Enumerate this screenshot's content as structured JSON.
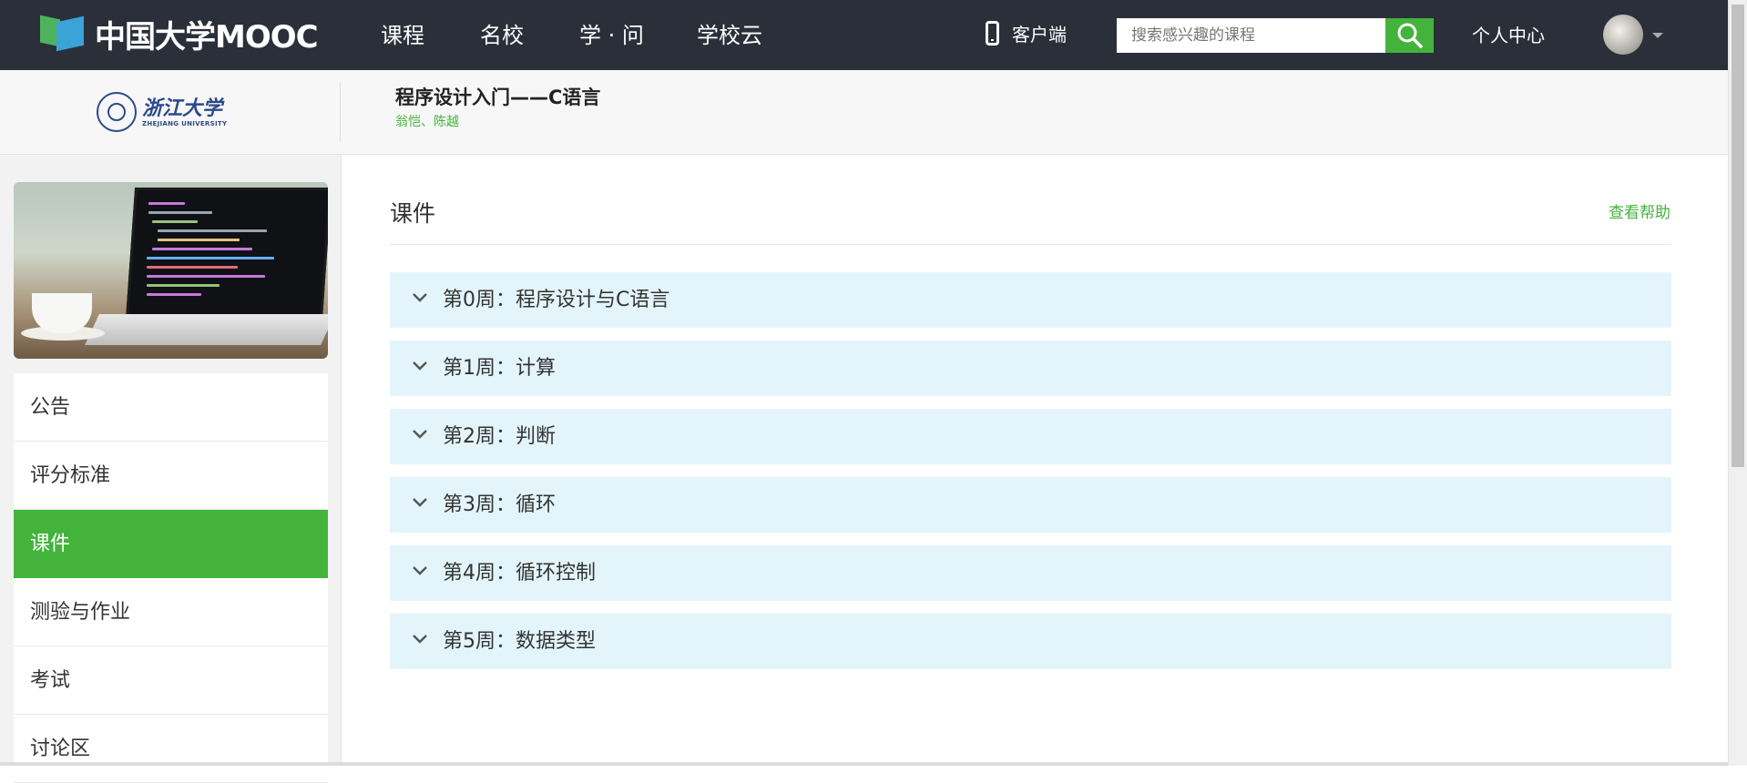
{
  "nav": {
    "logo_text": "中国大学MOOC",
    "items": [
      "课程",
      "名校",
      "学 · 问",
      "学校云"
    ],
    "client_label": "客户端",
    "search_placeholder": "搜索感兴趣的课程",
    "personal_center": "个人中心"
  },
  "course": {
    "school_logo_text": "浙江大学",
    "school_logo_en": "ZHEJIANG UNIVERSITY",
    "title": "程序设计入门——C语言",
    "teachers": "翁恺、陈越"
  },
  "sidebar": {
    "items": [
      {
        "label": "公告",
        "active": false
      },
      {
        "label": "评分标准",
        "active": false
      },
      {
        "label": "课件",
        "active": true
      },
      {
        "label": "测验与作业",
        "active": false
      },
      {
        "label": "考试",
        "active": false
      },
      {
        "label": "讨论区",
        "active": false
      }
    ]
  },
  "main": {
    "title": "课件",
    "help_link": "查看帮助",
    "weeks": [
      "第0周：程序设计与C语言",
      "第1周：计算",
      "第2周：判断",
      "第3周：循环",
      "第4周：循环控制",
      "第5周：数据类型"
    ]
  },
  "colors": {
    "nav_bg": "#2b2f3a",
    "accent_green": "#43b33c",
    "week_bg": "#e3f5fb"
  },
  "icons": {
    "search": "search-icon",
    "phone": "phone-icon",
    "chevron": "chevron-down-icon",
    "caret": "caret-down-icon"
  }
}
